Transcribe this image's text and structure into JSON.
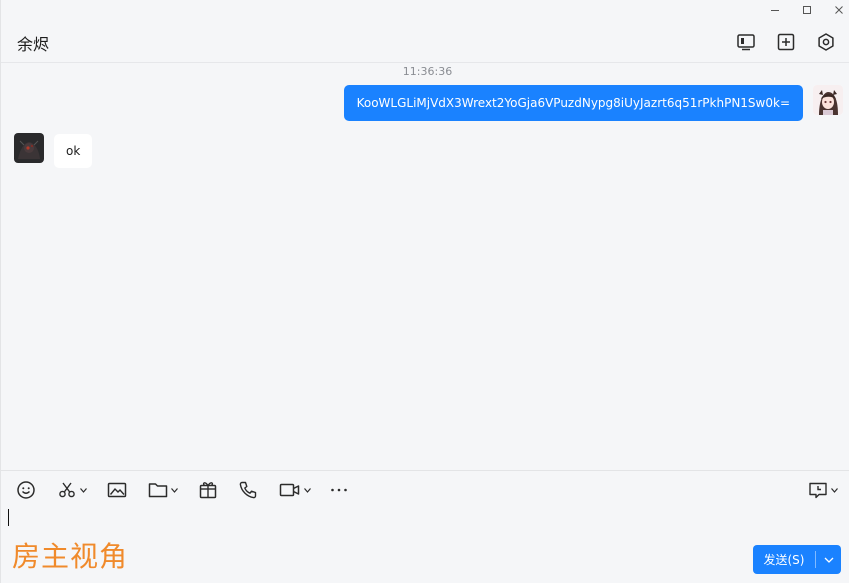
{
  "window": {
    "controls": [
      "minimize-icon",
      "maximize-icon",
      "close-icon"
    ]
  },
  "header": {
    "title": "余烬",
    "actions": [
      "screen-share-icon",
      "add-member-icon",
      "settings-icon"
    ]
  },
  "chat": {
    "timestamp": "11:36:36",
    "messages": [
      {
        "sender": "me",
        "text": "KooWLGLiMjVdX3Wrext2YoGja6VPuzdNypg8iUyJazrt6q51rPkhPN1Sw0k="
      },
      {
        "sender": "other",
        "text": "ok"
      }
    ]
  },
  "toolbar": {
    "tools": [
      "emoji-icon",
      "screenshot-icon",
      "image-icon",
      "file-icon",
      "red-packet-icon",
      "voice-call-icon",
      "video-call-icon",
      "more-icon"
    ],
    "right_tool": "history-icon"
  },
  "composer": {
    "value": ""
  },
  "overlay": {
    "watermark": "房主视角"
  },
  "send": {
    "label": "发送(S)"
  },
  "colors": {
    "accent": "#1a82ff",
    "watermark": "#f08a2b",
    "background": "#f5f6f8"
  }
}
